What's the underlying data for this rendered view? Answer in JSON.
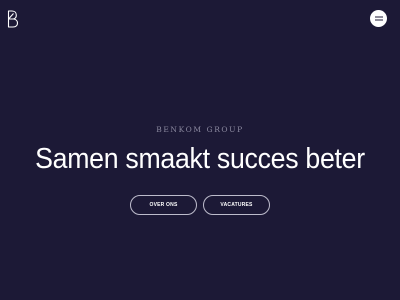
{
  "header": {
    "logo_icon": "benkom-b-logo-icon",
    "menu_icon": "hamburger-menu-icon"
  },
  "hero": {
    "eyebrow": "BENKOM GROUP",
    "headline": "Samen smaakt succes beter",
    "buttons": [
      {
        "label": "OVER ONS"
      },
      {
        "label": "VACATURES"
      }
    ]
  },
  "colors": {
    "background": "#1c1936",
    "text": "#ffffff",
    "eyebrow": "#8c8aa0",
    "button_border": "#bdbccc"
  }
}
